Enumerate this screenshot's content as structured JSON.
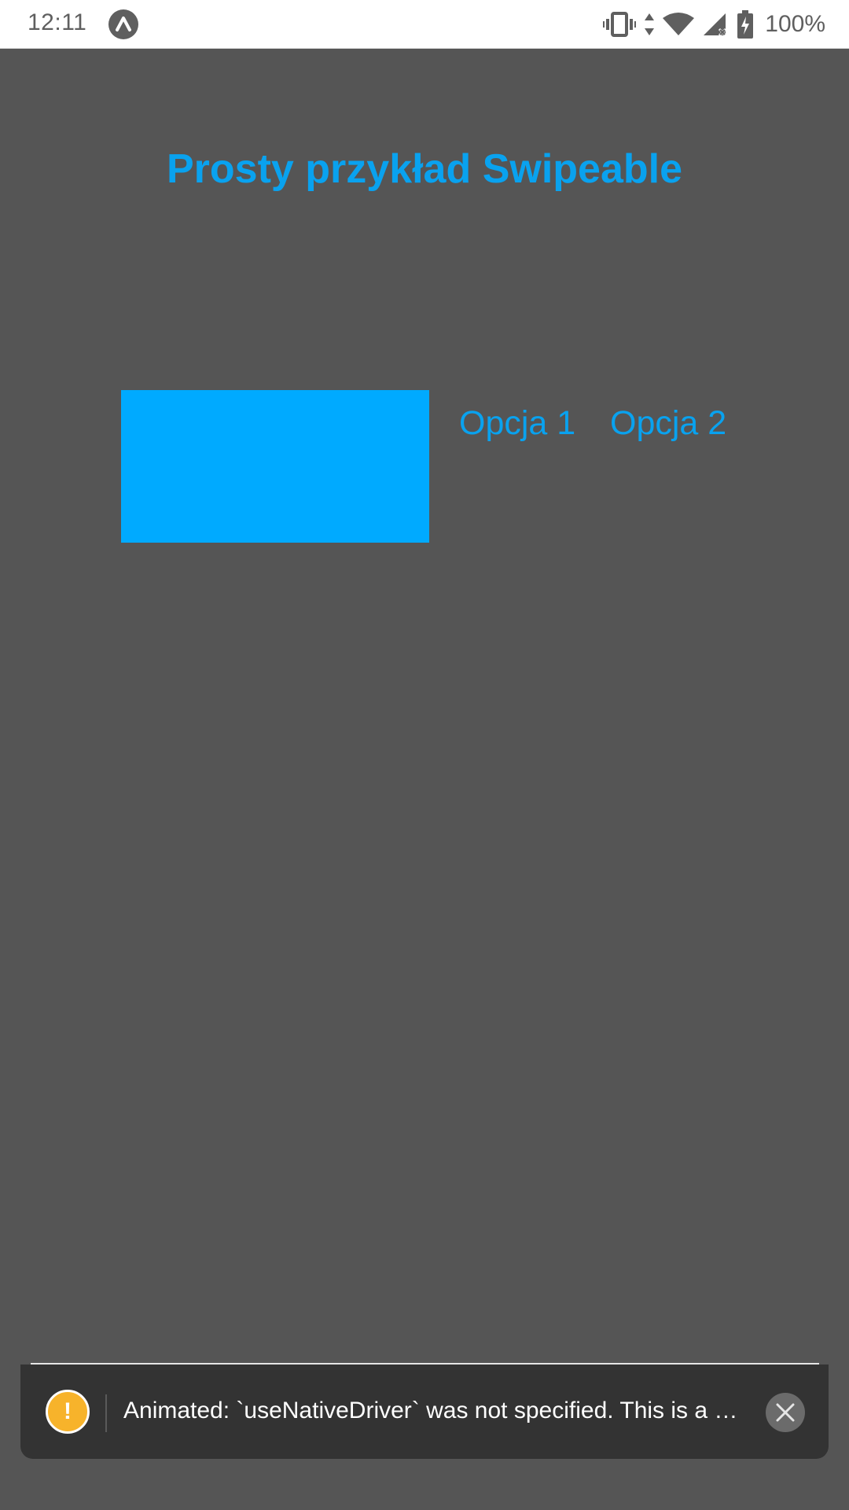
{
  "status_bar": {
    "time": "12:11",
    "battery": "100%",
    "icons": [
      "expo-icon",
      "vibrate-icon",
      "data-arrows-icon",
      "wifi-icon",
      "cell-signal-icon",
      "battery-charging-icon"
    ]
  },
  "screen": {
    "title": "Prosty przykład Swipeable",
    "swipe_row": {
      "card_color": "#00aaff",
      "options": [
        "Opcja 1",
        "Opcja 2"
      ]
    }
  },
  "toast": {
    "icon": "warning-icon",
    "icon_glyph": "!",
    "message": "Animated: `useNativeDriver` was not specified. This is a …",
    "close_icon": "close-icon"
  },
  "colors": {
    "background": "#555555",
    "accent": "#09a2ef",
    "warning": "#f7b32b",
    "toast_bg": "#333333"
  }
}
